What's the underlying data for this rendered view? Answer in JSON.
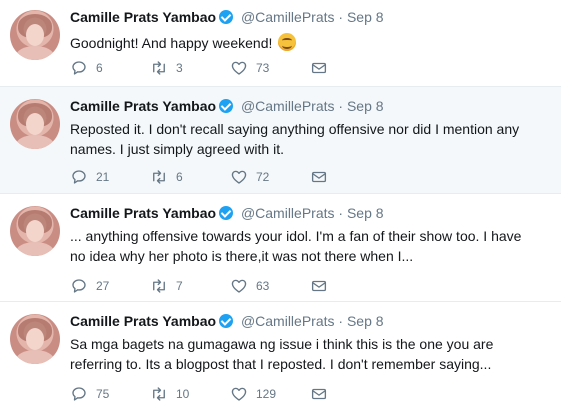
{
  "tweets": [
    {
      "name": "Camille Prats Yambao",
      "handle": "@CamillePrats",
      "separator": "·",
      "date": "Sep 8",
      "text": "Goodnight! And happy weekend!",
      "emoji": "smiling-face",
      "replies": "6",
      "retweets": "3",
      "likes": "73"
    },
    {
      "name": "Camille Prats Yambao",
      "handle": "@CamillePrats",
      "separator": "·",
      "date": "Sep 8",
      "text": "Reposted it. I don't recall saying anything offensive nor did I mention any names. I just simply agreed with it.",
      "replies": "21",
      "retweets": "6",
      "likes": "72"
    },
    {
      "name": "Camille Prats Yambao",
      "handle": "@CamillePrats",
      "separator": "·",
      "date": "Sep 8",
      "text": "... anything offensive towards your idol. I'm a fan of their show too. I have no idea why her photo is there,it was not there when I...",
      "replies": "27",
      "retweets": "7",
      "likes": "63"
    },
    {
      "name": "Camille Prats Yambao",
      "handle": "@CamillePrats",
      "separator": "·",
      "date": "Sep 8",
      "text": "Sa mga bagets na gumagawa ng issue i think this is the one you are referring to. Its a blogpost that I reposted. I don't remember saying...",
      "replies": "75",
      "retweets": "10",
      "likes": "129"
    }
  ],
  "colors": {
    "text": "#14171a",
    "muted": "#657786",
    "verified": "#1da1f2",
    "highlight_bg": "#f5f8fa",
    "divider": "#e6ecf0"
  },
  "icons": {
    "reply": "reply-icon",
    "retweet": "retweet-icon",
    "like": "heart-icon",
    "message": "envelope-icon",
    "verified": "verified-badge-icon"
  }
}
